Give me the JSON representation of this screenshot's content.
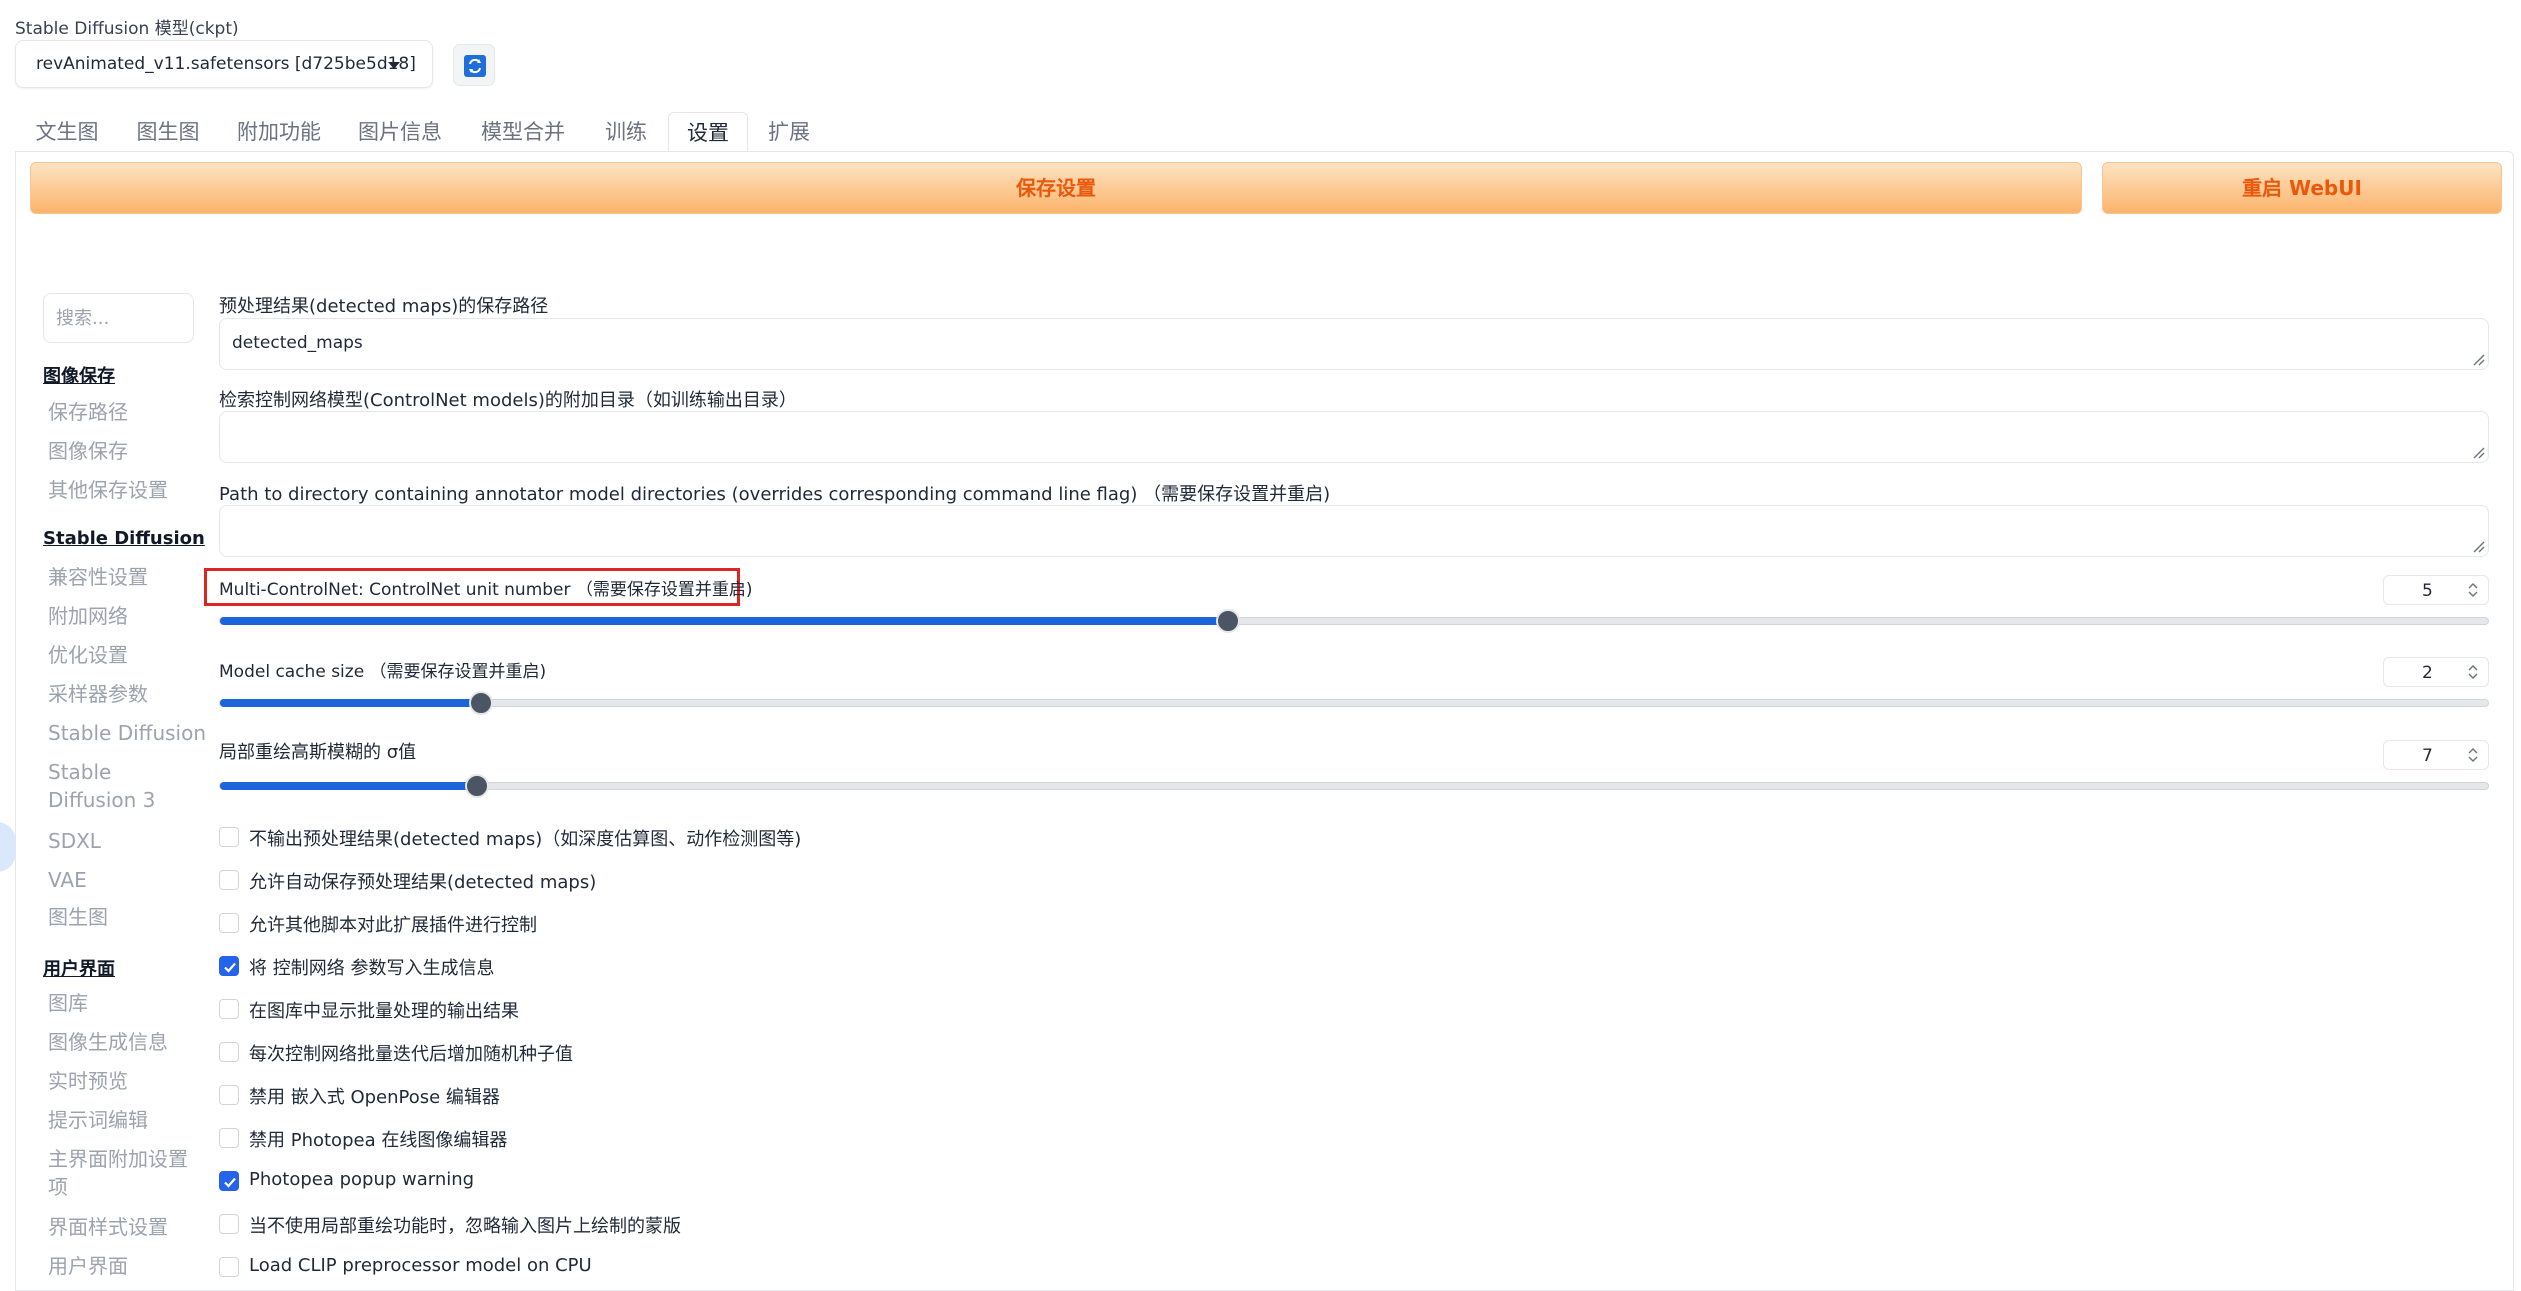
{
  "model": {
    "label": "Stable Diffusion 模型(ckpt)",
    "selected": "revAnimated_v11.safetensors [d725be5d18]",
    "refresh_icon": "refresh-icon"
  },
  "tabs": [
    "文生图",
    "图生图",
    "附加功能",
    "图片信息",
    "模型合并",
    "训练",
    "设置",
    "扩展"
  ],
  "active_tab": "设置",
  "actions": {
    "save": "保存设置",
    "restart": "重启 WebUI"
  },
  "sidebar": {
    "search_placeholder": "搜索...",
    "groups": [
      {
        "title": "图像保存",
        "items": [
          "保存路径",
          "图像保存",
          "其他保存设置"
        ]
      },
      {
        "title": "Stable Diffusion",
        "items": [
          "兼容性设置",
          "附加网络",
          "优化设置",
          "采样器参数",
          "Stable Diffusion",
          "Stable Diffusion 3",
          "SDXL",
          "VAE",
          "图生图"
        ]
      },
      {
        "title": "用户界面",
        "items": [
          "图库",
          "图像生成信息",
          "实时预览",
          "提示词编辑",
          "主界面附加设置项",
          "界面样式设置",
          "用户界面"
        ]
      }
    ]
  },
  "settings": {
    "detected_maps_path": {
      "label": "预处理结果(detected maps)的保存路径",
      "value": "detected_maps"
    },
    "controlnet_models_dir": {
      "label": "检索控制网络模型(ControlNet models)的附加目录（如训练输出目录）",
      "value": ""
    },
    "annotator_models_dir": {
      "label": "Path to directory containing annotator model directories (overrides corresponding command line flag) （需要保存设置并重启)",
      "value": ""
    },
    "multi_controlnet": {
      "label": "Multi-ControlNet: ControlNet unit number （需要保存设置并重启)",
      "value": "5",
      "fraction": 0.444
    },
    "model_cache": {
      "label": "Model cache size （需要保存设置并重启)",
      "value": "2",
      "fraction": 0.115
    },
    "inpaint_sigma": {
      "label": "局部重绘高斯模糊的 σ值",
      "value": "7",
      "fraction": 0.113
    },
    "checkboxes": [
      {
        "label": "不输出预处理结果(detected maps)（如深度估算图、动作检测图等)",
        "checked": false
      },
      {
        "label": "允许自动保存预处理结果(detected maps)",
        "checked": false
      },
      {
        "label": "允许其他脚本对此扩展插件进行控制",
        "checked": false
      },
      {
        "label": "将 控制网络 参数写入生成信息",
        "checked": true
      },
      {
        "label": "在图库中显示批量处理的输出结果",
        "checked": false
      },
      {
        "label": "每次控制网络批量迭代后增加随机种子值",
        "checked": false
      },
      {
        "label": "禁用 嵌入式 OpenPose 编辑器",
        "checked": false
      },
      {
        "label": "禁用 Photopea 在线图像编辑器",
        "checked": false
      },
      {
        "label": "Photopea popup warning",
        "checked": true
      },
      {
        "label": "当不使用局部重绘功能时，忽略输入图片上绘制的蒙版",
        "checked": false
      },
      {
        "label": "Load CLIP preprocessor model on CPU",
        "checked": false
      }
    ]
  }
}
